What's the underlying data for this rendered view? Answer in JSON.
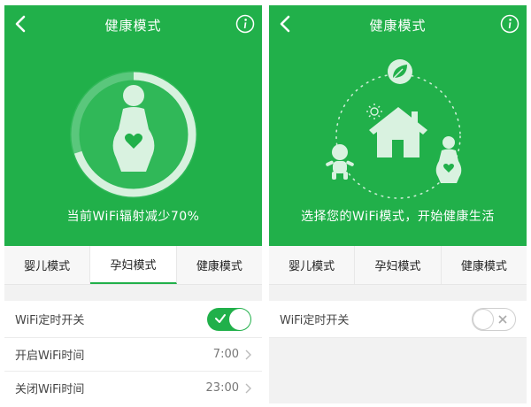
{
  "colors": {
    "brand_green": "#21b04a",
    "text": "#444444",
    "muted": "#777777"
  },
  "left": {
    "title": "健康模式",
    "hero_caption": "当前WiFi辐射减少70%",
    "radiation_reduction_percent": 70,
    "tabs": [
      {
        "label": "婴儿模式",
        "active": false
      },
      {
        "label": "孕妇模式",
        "active": true
      },
      {
        "label": "健康模式",
        "active": false
      }
    ],
    "settings": {
      "timer_switch_label": "WiFi定时开关",
      "timer_switch_on": true,
      "open_time_label": "开启WiFi时间",
      "open_time_value": "7:00",
      "close_time_label": "关闭WiFi时间",
      "close_time_value": "23:00"
    }
  },
  "right": {
    "title": "健康模式",
    "hero_caption": "选择您的WiFi模式，开始健康生活",
    "tabs": [
      {
        "label": "婴儿模式",
        "active": false
      },
      {
        "label": "孕妇模式",
        "active": false
      },
      {
        "label": "健康模式",
        "active": false
      }
    ],
    "settings": {
      "timer_switch_label": "WiFi定时开关",
      "timer_switch_on": false
    }
  },
  "icons": {
    "back": "chevron-left-icon",
    "info": "info-icon",
    "pregnant": "pregnant-woman-icon",
    "baby": "baby-icon",
    "house": "house-icon",
    "leaf": "leaf-icon",
    "sun": "sun-icon"
  }
}
